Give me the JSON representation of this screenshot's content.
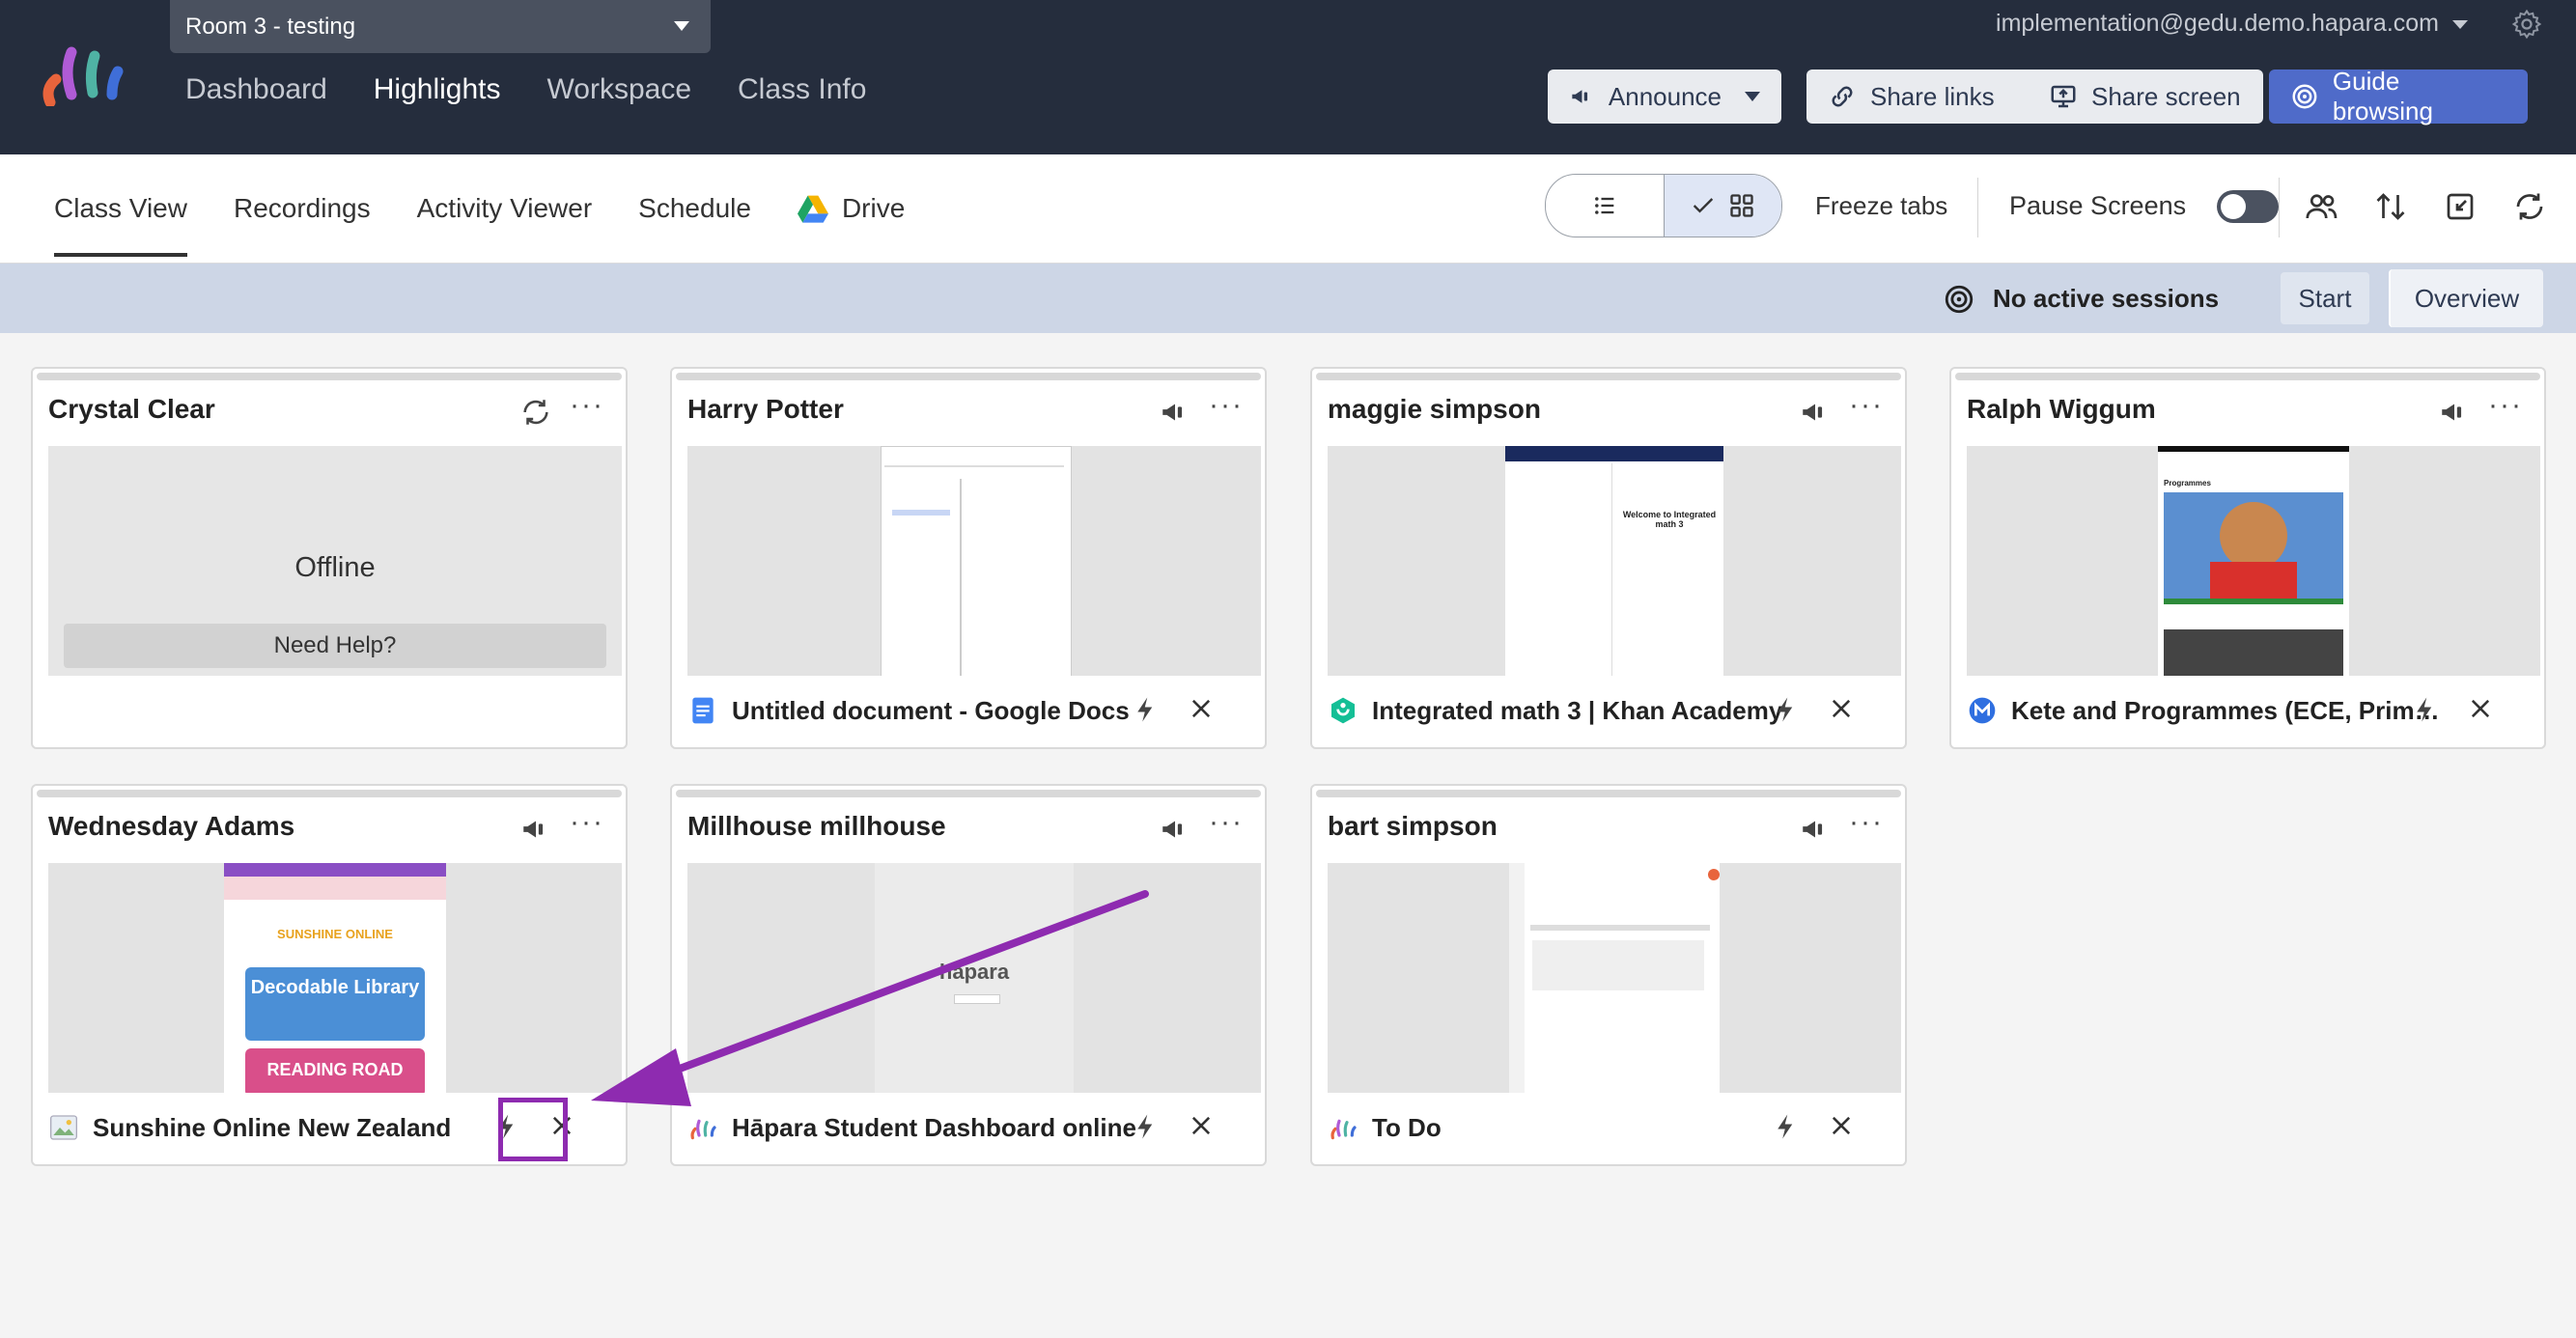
{
  "topbar": {
    "class_selector": "Room 3 - testing",
    "nav": [
      "Dashboard",
      "Highlights",
      "Workspace",
      "Class Info"
    ],
    "active_nav": "Highlights",
    "user_email": "implementation@gedu.demo.hapara.com",
    "buttons": {
      "announce": "Announce",
      "share_links": "Share links",
      "share_screen": "Share screen",
      "guide_browsing": "Guide browsing"
    }
  },
  "subbar": {
    "tabs": [
      "Class View",
      "Recordings",
      "Activity Viewer",
      "Schedule",
      "Drive"
    ],
    "active_tab": "Class View",
    "freeze_tabs": "Freeze tabs",
    "pause_screens": "Pause Screens"
  },
  "sessions": {
    "status": "No active sessions",
    "start": "Start",
    "overview": "Overview"
  },
  "students": [
    {
      "name": "Crystal Clear",
      "status": "Offline",
      "help": "Need Help?"
    },
    {
      "name": "Harry Potter",
      "tab": "Untitled document - Google Docs"
    },
    {
      "name": "maggie simpson",
      "tab": "Integrated math 3 | Khan Academy"
    },
    {
      "name": "Ralph Wiggum",
      "tab": "Kete and Programmes (ECE, Primary)"
    },
    {
      "name": "Wednesday Adams",
      "tab": "Sunshine Online New Zealand"
    },
    {
      "name": "Millhouse millhouse",
      "tab": "Hāpara Student Dashboard online"
    },
    {
      "name": "bart simpson",
      "tab": "To Do"
    }
  ],
  "thumbs": {
    "sunshine_header": "SUNSHINE ONLINE",
    "decodable": "Decodable Library",
    "reading": "READING ROAD",
    "hapara_logo": "hāpara",
    "khan_welcome": "Welcome to Integrated math 3",
    "ralph_heading": "Programmes"
  },
  "colors": {
    "topbar": "#252d3d",
    "guide_button": "#4f6bc9",
    "annotation": "#8e2bb0",
    "sessions_bar": "#cdd6e6"
  }
}
